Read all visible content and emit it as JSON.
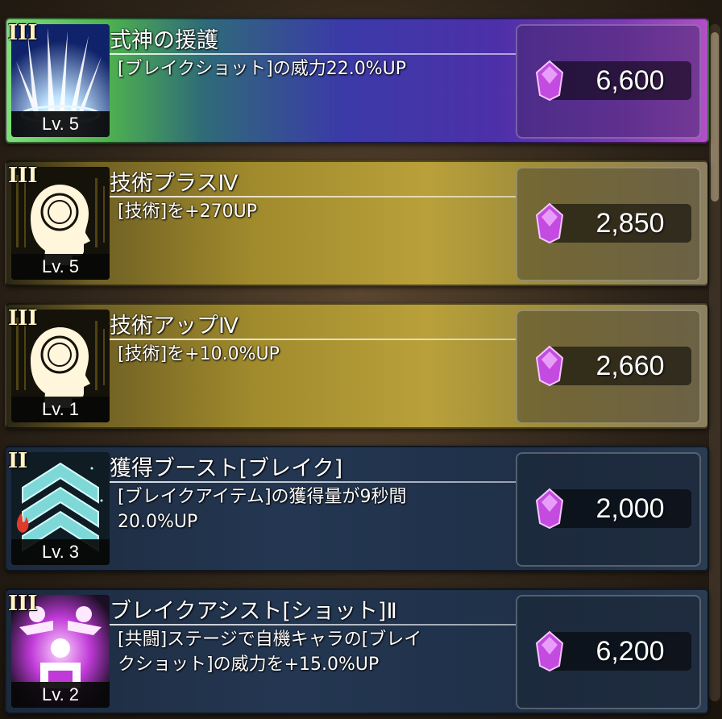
{
  "skills": [
    {
      "rank": "III",
      "level": "Lv. 5",
      "title": "式神の援護",
      "description": "[ブレイクショット]の威力22.0%UP",
      "price": "6,600",
      "icon": "light-burst-icon",
      "theme": "rainbow"
    },
    {
      "rank": "III",
      "level": "Lv. 5",
      "title": "技術プラスⅣ",
      "description": "[技術]を+270UP",
      "price": "2,850",
      "icon": "head-brain-icon",
      "theme": "gold"
    },
    {
      "rank": "III",
      "level": "Lv. 1",
      "title": "技術アップⅣ",
      "description": "[技術]を+10.0%UP",
      "price": "2,660",
      "icon": "head-brain-icon",
      "theme": "gold"
    },
    {
      "rank": "II",
      "level": "Lv. 3",
      "title": "獲得ブースト[ブレイク]",
      "description": "[ブレイクアイテム]の獲得量が9秒間\n20.0%UP",
      "price": "2,000",
      "icon": "chevron-boost-icon",
      "theme": "navy"
    },
    {
      "rank": "III",
      "level": "Lv. 2",
      "title": "ブレイクアシスト[ショット]Ⅱ",
      "description": "[共闘]ステージで自機キャラの[ブレイ\nクショット]の威力を+15.0%UP",
      "price": "6,200",
      "icon": "assist-figures-icon",
      "theme": "navy"
    }
  ],
  "colors": {
    "gem": "#c44be0",
    "gold_panel": "#b9a03a",
    "navy_panel": "#243752"
  }
}
